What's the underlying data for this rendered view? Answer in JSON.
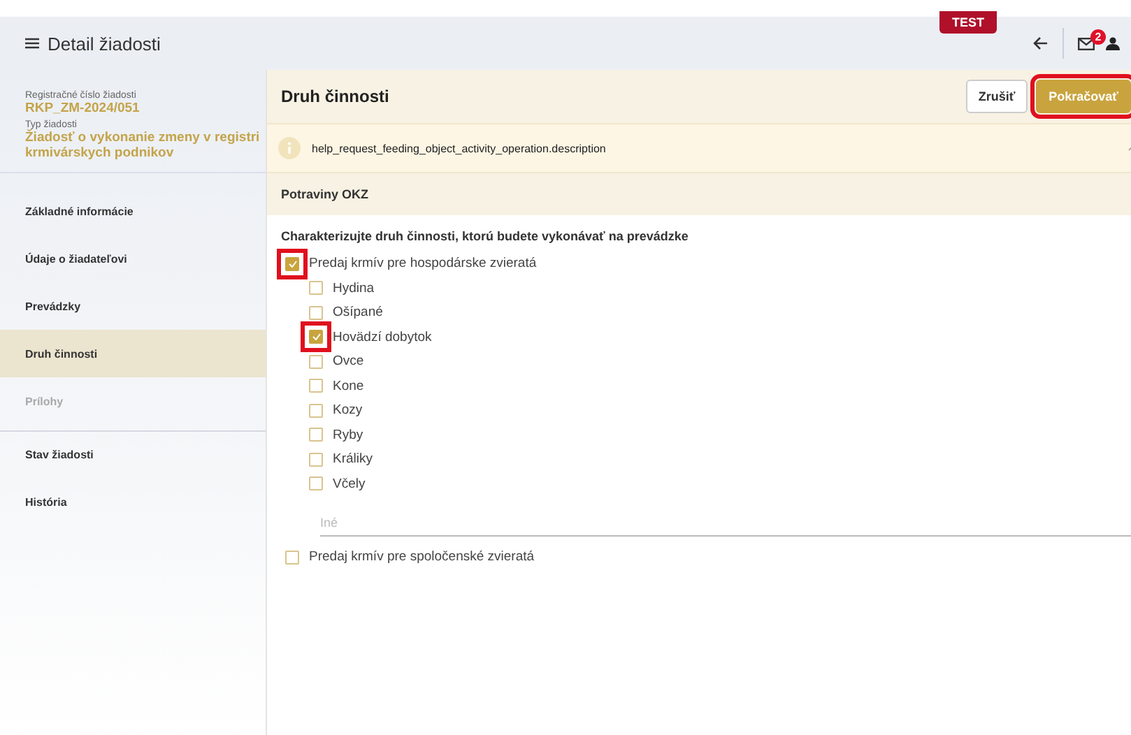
{
  "header": {
    "title": "Detail žiadosti",
    "env_badge": "TEST",
    "mail_count": "2"
  },
  "sidebar": {
    "fields": [
      {
        "label": "Registračné číslo žiadosti",
        "value": "RKP_ZM-2024/051"
      },
      {
        "label": "Typ žiadosti",
        "value": "Žiadosť o vykonanie zmeny v registri krmivárskych podnikov"
      }
    ],
    "items": [
      {
        "label": "Základné informácie",
        "selected": false,
        "disabled": false,
        "divider_before": false
      },
      {
        "label": "Údaje o žiadateľovi",
        "selected": false,
        "disabled": false,
        "divider_before": false
      },
      {
        "label": "Prevádzky",
        "selected": false,
        "disabled": false,
        "divider_before": false
      },
      {
        "label": "Druh činnosti",
        "selected": true,
        "disabled": false,
        "divider_before": false
      },
      {
        "label": "Prílohy",
        "selected": false,
        "disabled": true,
        "divider_before": false
      },
      {
        "label": "Stav žiadosti",
        "selected": false,
        "disabled": false,
        "divider_before": true
      },
      {
        "label": "História",
        "selected": false,
        "disabled": false,
        "divider_before": false
      }
    ]
  },
  "panel": {
    "title": "Druh činnosti",
    "buttons": [
      {
        "label": "Zrušiť",
        "kind": "secondary",
        "highlighted": false
      },
      {
        "label": "Pokračovať",
        "kind": "primary",
        "highlighted": true
      }
    ],
    "info": "help_request_feeding_object_activity_operation.description",
    "section": "Potraviny OKZ",
    "question": "Charakterizujte druh činnosti, ktorú budete vykonávať na prevádzke",
    "options": [
      {
        "label": "Predaj krmív pre hospodárske zvieratá",
        "checked": true,
        "highlighted": true,
        "children": [
          {
            "label": "Hydina",
            "checked": false,
            "highlighted": false
          },
          {
            "label": "Ošípané",
            "checked": false,
            "highlighted": false
          },
          {
            "label": "Hovädzí dobytok",
            "checked": true,
            "highlighted": true
          },
          {
            "label": "Ovce",
            "checked": false,
            "highlighted": false
          },
          {
            "label": "Kone",
            "checked": false,
            "highlighted": false
          },
          {
            "label": "Kozy",
            "checked": false,
            "highlighted": false
          },
          {
            "label": "Ryby",
            "checked": false,
            "highlighted": false
          },
          {
            "label": "Králiky",
            "checked": false,
            "highlighted": false
          },
          {
            "label": "Včely",
            "checked": false,
            "highlighted": false
          }
        ],
        "other_placeholder": "Iné"
      },
      {
        "label": "Predaj krmív pre spoločenské zvieratá",
        "checked": false,
        "highlighted": false
      }
    ]
  }
}
